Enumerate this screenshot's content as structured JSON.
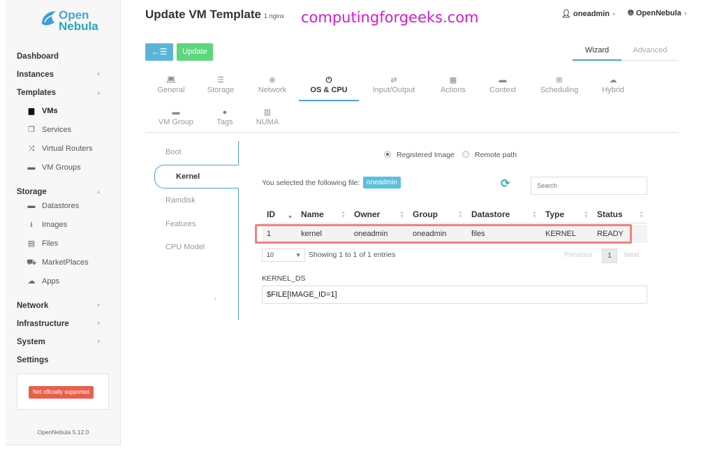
{
  "brand": {
    "line1": "Open",
    "line2": "Nebula",
    "version": "OpenNebula 5.12.0",
    "notice": "Not officially supported"
  },
  "header": {
    "title": "Update VM Template",
    "subtitle": "1  nginx",
    "watermark": "computingforgeeks.com",
    "user": "oneadmin",
    "zone": "OpenNebula"
  },
  "sidebar": {
    "dashboard": "Dashboard",
    "instances": "Instances",
    "templates": "Templates",
    "templates_items": [
      {
        "label": "VMs",
        "icon": "file-icon"
      },
      {
        "label": "Services",
        "icon": "copy-icon"
      },
      {
        "label": "Virtual Routers",
        "icon": "random-icon"
      },
      {
        "label": "VM Groups",
        "icon": "folder-icon"
      }
    ],
    "storage": "Storage",
    "storage_items": [
      {
        "label": "Datastores",
        "icon": "folder-icon"
      },
      {
        "label": "Images",
        "icon": "download-icon"
      },
      {
        "label": "Files",
        "icon": "archive-icon"
      },
      {
        "label": "MarketPlaces",
        "icon": "cart-icon"
      },
      {
        "label": "Apps",
        "icon": "cloud-download-icon"
      }
    ],
    "network": "Network",
    "infrastructure": "Infrastructure",
    "system": "System",
    "settings": "Settings"
  },
  "toolbar": {
    "back_icon": "←☰",
    "update": "Update",
    "wizard": "Wizard",
    "advanced": "Advanced"
  },
  "section_tabs": [
    {
      "label": "General",
      "icon": "laptop-icon"
    },
    {
      "label": "Storage",
      "icon": "database-icon"
    },
    {
      "label": "Network",
      "icon": "globe-icon"
    },
    {
      "label": "OS & CPU",
      "icon": "power-icon"
    },
    {
      "label": "Input/Output",
      "icon": "exchange-icon"
    },
    {
      "label": "Actions",
      "icon": "calendar-icon"
    },
    {
      "label": "Context",
      "icon": "folder-icon"
    },
    {
      "label": "Scheduling",
      "icon": "sitemap-icon"
    },
    {
      "label": "Hybrid",
      "icon": "cloud-icon"
    },
    {
      "label": "VM Group",
      "icon": "folder-open-icon"
    },
    {
      "label": "Tags",
      "icon": "tag-icon"
    },
    {
      "label": "NUMA",
      "icon": "chip-icon"
    }
  ],
  "vertical_tabs": {
    "boot": "Boot",
    "kernel": "Kernel",
    "ramdisk": "Ramdisk",
    "features": "Features",
    "cpu_model": "CPU Model"
  },
  "kernel": {
    "radio_registered": "Registered Image",
    "radio_remote": "Remote path",
    "selected_label": "You selected the following file:",
    "selected_file": "oneadmin",
    "search_placeholder": "Search",
    "columns": [
      "ID",
      "Name",
      "Owner",
      "Group",
      "Datastore",
      "Type",
      "Status"
    ],
    "rows": [
      {
        "id": "1",
        "name": "kernel",
        "owner": "oneadmin",
        "group": "oneadmin",
        "datastore": "files",
        "type": "KERNEL",
        "status": "READY"
      }
    ],
    "page_size": "10",
    "showing": "Showing 1 to 1 of 1 entries",
    "previous": "Previous",
    "current_page": "1",
    "next": "Next",
    "kernel_ds_label": "KERNEL_DS",
    "kernel_ds_value": "$FILE[IMAGE_ID=1]"
  }
}
